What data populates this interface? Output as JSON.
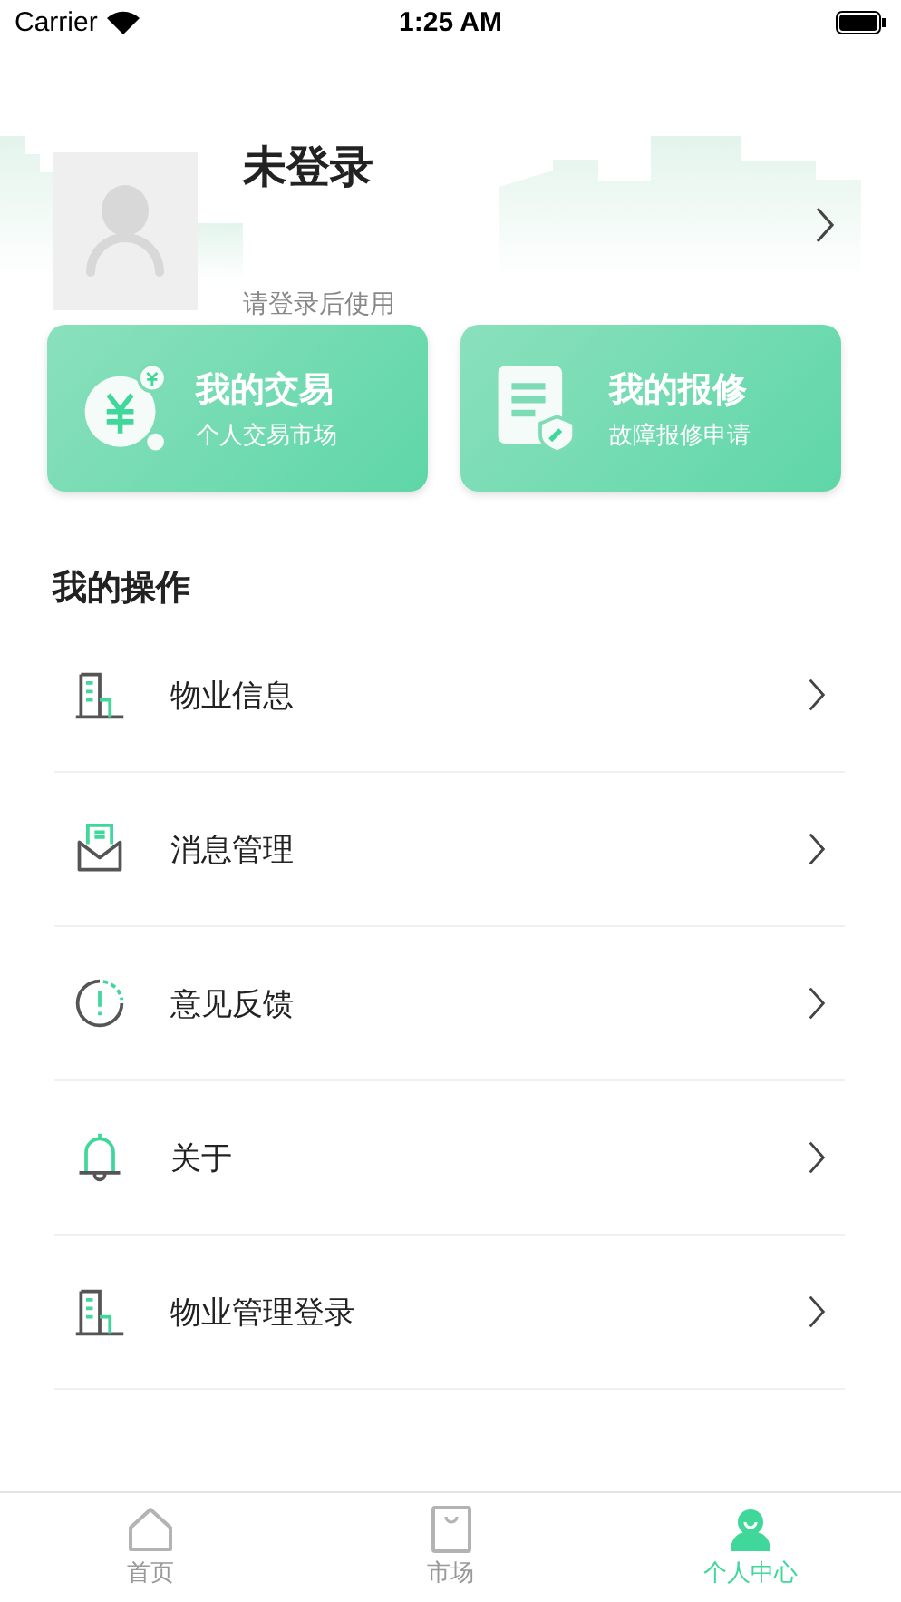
{
  "status_bar": {
    "carrier": "Carrier",
    "time": "1:25 AM"
  },
  "profile": {
    "name": "未登录",
    "subtitle": "请登录后使用"
  },
  "cards": [
    {
      "kind": "trade",
      "title": "我的交易",
      "subtitle": "个人交易市场"
    },
    {
      "kind": "repair",
      "title": "我的报修",
      "subtitle": "故障报修申请"
    }
  ],
  "section_title": "我的操作",
  "menu": [
    {
      "kind": "building",
      "label": "物业信息"
    },
    {
      "kind": "mail",
      "label": "消息管理"
    },
    {
      "kind": "feedback",
      "label": "意见反馈"
    },
    {
      "kind": "bell",
      "label": "关于"
    },
    {
      "kind": "building",
      "label": "物业管理登录"
    }
  ],
  "tabs": [
    {
      "kind": "home",
      "label": "首页",
      "selected": false
    },
    {
      "kind": "bag",
      "label": "市场",
      "selected": false
    },
    {
      "kind": "person",
      "label": "个人中心",
      "selected": true
    }
  ]
}
